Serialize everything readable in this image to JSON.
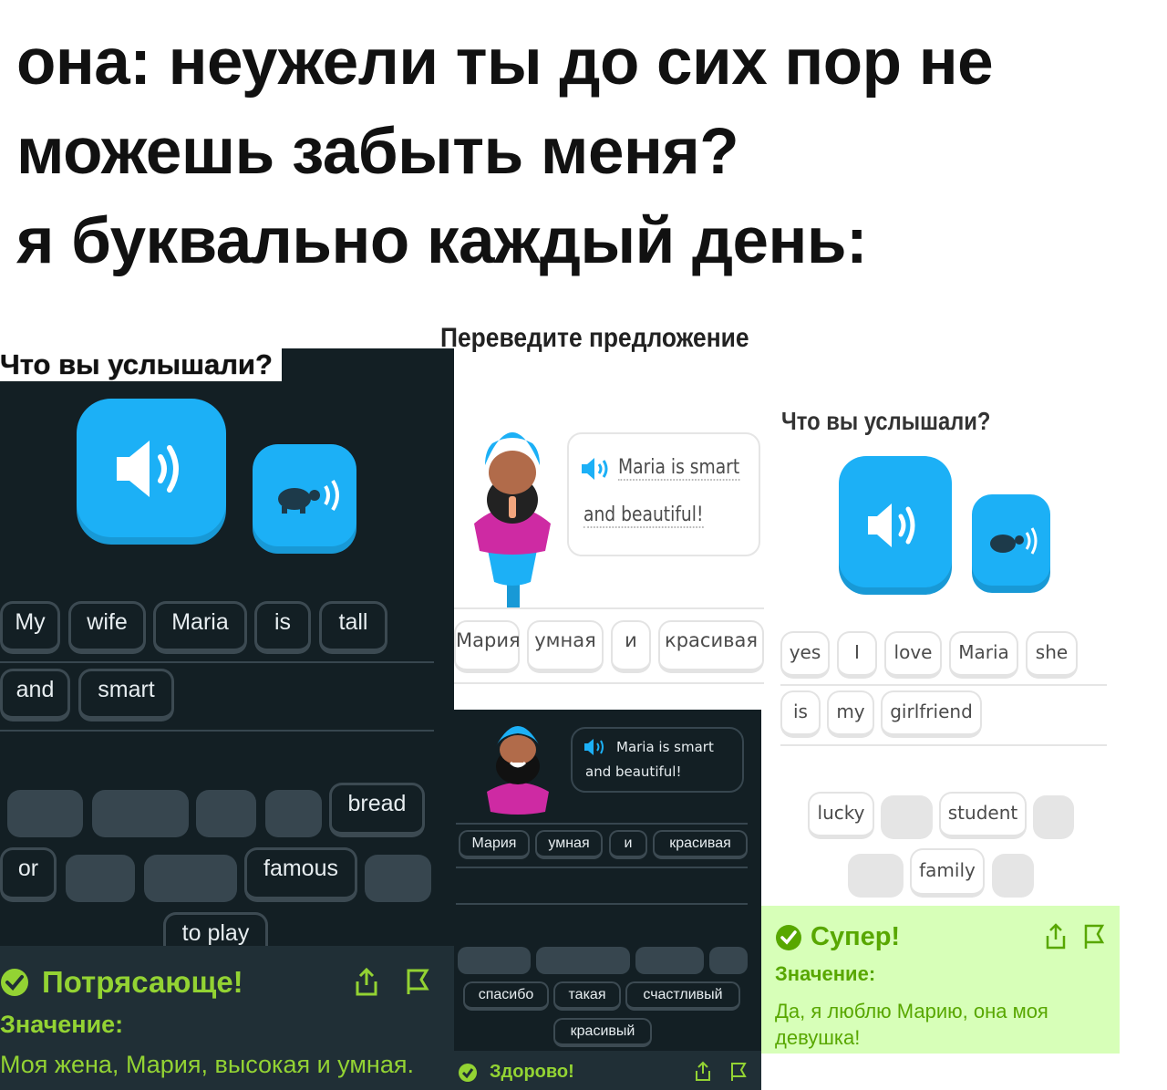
{
  "meme": {
    "caption_line1": "она: неужели ты до сих пор не",
    "caption_line2": "можешь забыть меня?",
    "caption_line3": "я буквально каждый день:"
  },
  "panel1": {
    "title": "Что вы услышали?",
    "answer_words": [
      "My",
      "wife",
      "Maria",
      "is",
      "tall",
      "and",
      "smart"
    ],
    "bank_words": [
      "bread",
      "or",
      "famous",
      "to play"
    ],
    "feedback_title": "Потрясающе!",
    "meaning_label": "Значение:",
    "meaning_text": "Моя жена, Мария, высокая и умная."
  },
  "panel2": {
    "title": "Переведите предложение",
    "bubble_line1": "Maria is smart",
    "bubble_line2": "and beautiful!",
    "answer_words": [
      "Мария",
      "умная",
      "и",
      "красивая"
    ],
    "small_bubble_line1": "Maria is smart",
    "small_bubble_line2": "and beautiful!",
    "small_answer_words": [
      "Мария",
      "умная",
      "и",
      "красивая"
    ],
    "small_bank_words": [
      "спасибо",
      "такая",
      "счастливый",
      "красивый"
    ],
    "feedback_title": "Здорово!"
  },
  "panel3": {
    "title": "Что вы услышали?",
    "answer_words": [
      "yes",
      "I",
      "love",
      "Maria",
      "she",
      "is",
      "my",
      "girlfriend"
    ],
    "bank_words": [
      "lucky",
      "student",
      "family"
    ],
    "feedback_title": "Супер!",
    "meaning_label": "Значение:",
    "meaning_text": "Да, я люблю Марию, она моя девушка!"
  },
  "colors": {
    "dark_bg": "#131f24",
    "dark_footer": "#202f36",
    "speaker_blue": "#1cb0f6",
    "correct_green_dark": "#93d333",
    "correct_green_light": "#58a700",
    "correct_bg_light": "#d7ffb8"
  }
}
